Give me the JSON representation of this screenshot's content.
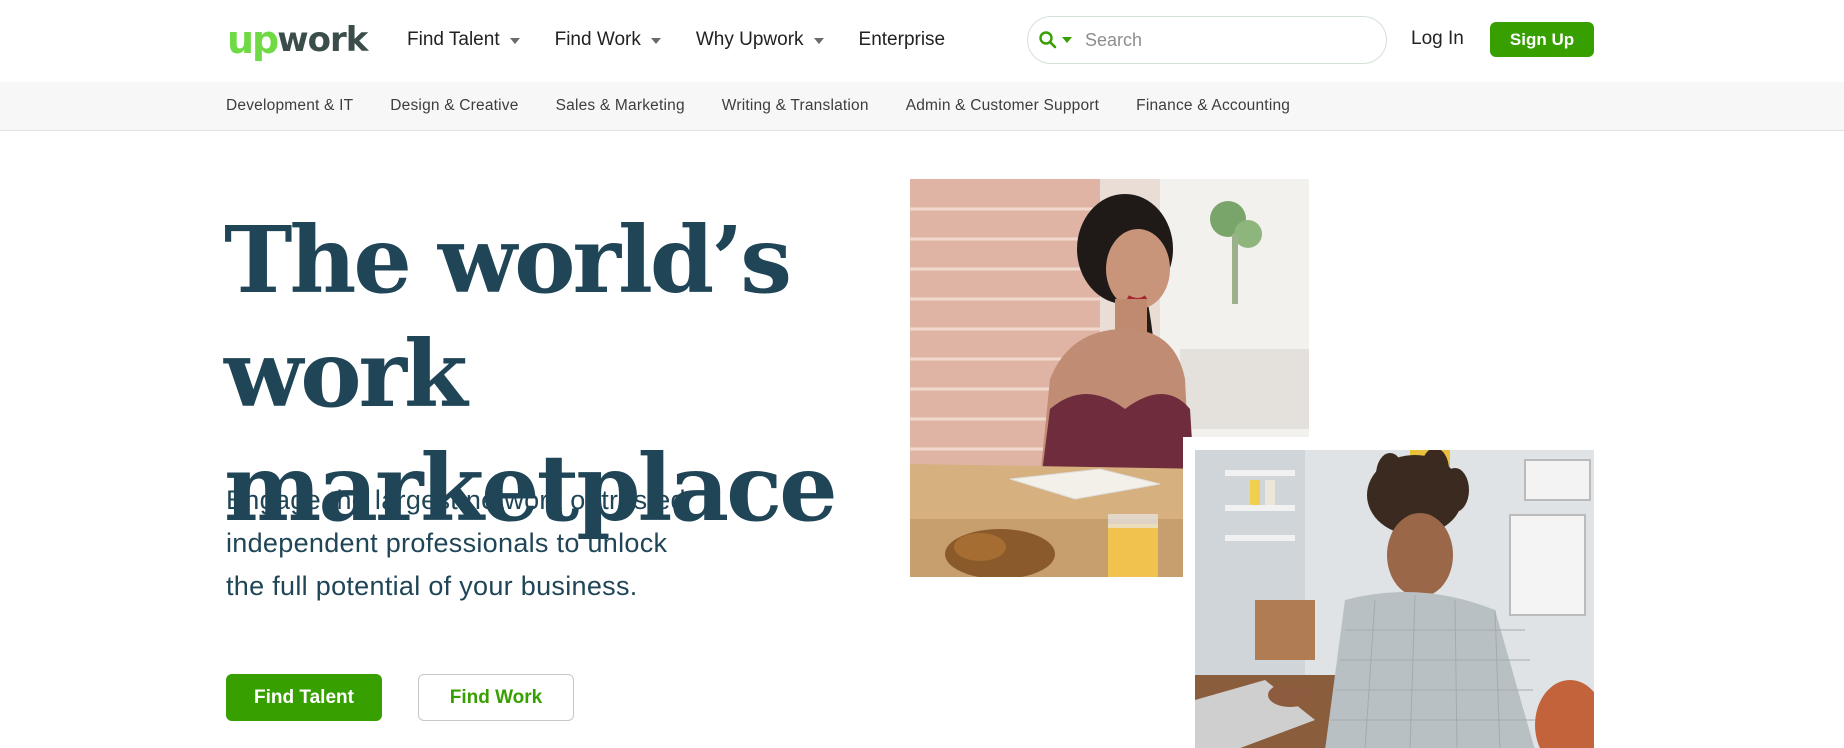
{
  "brand": {
    "logo_up": "up",
    "logo_work": "work",
    "accent_color": "#37a000",
    "logo_green": "#6fda44",
    "heading_color": "#1f4557"
  },
  "nav": {
    "items": [
      {
        "label": "Find Talent",
        "has_dropdown": true
      },
      {
        "label": "Find Work",
        "has_dropdown": true
      },
      {
        "label": "Why Upwork",
        "has_dropdown": true
      },
      {
        "label": "Enterprise",
        "has_dropdown": false
      }
    ],
    "search": {
      "placeholder": "Search",
      "icon": "search-icon"
    },
    "login_label": "Log In",
    "signup_label": "Sign Up"
  },
  "categories": [
    "Development & IT",
    "Design & Creative",
    "Sales & Marketing",
    "Writing & Translation",
    "Admin & Customer Support",
    "Finance & Accounting"
  ],
  "hero": {
    "title_line1": "The world’s work",
    "title_line2": "marketplace",
    "subtitle_line1": "Engage the largest network of trusted",
    "subtitle_line2": "independent professionals to unlock",
    "subtitle_line3": "the full potential of your business.",
    "primary_button": "Find Talent",
    "secondary_button": "Find Work"
  }
}
